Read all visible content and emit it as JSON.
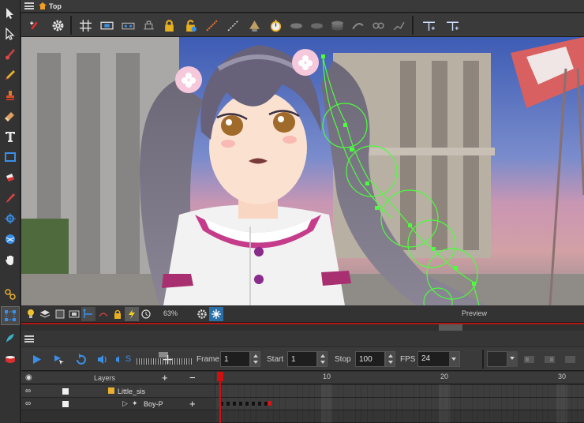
{
  "breadcrumb": {
    "label": "Top"
  },
  "left_tools": [
    {
      "name": "select-tool",
      "icon": "arrow-icon"
    },
    {
      "name": "contour-editor-tool",
      "icon": "arrow-white-icon"
    },
    {
      "name": "brush-tool",
      "icon": "brush-icon"
    },
    {
      "name": "pencil-tool",
      "icon": "pencil-icon"
    },
    {
      "name": "stamp-tool",
      "icon": "stamp-icon"
    },
    {
      "name": "eraser-tool",
      "icon": "eraser-icon"
    },
    {
      "name": "text-tool",
      "icon": "text-icon"
    },
    {
      "name": "rectangle-tool",
      "icon": "rectangle-icon"
    },
    {
      "name": "paint-tool",
      "icon": "paint-bucket-icon"
    },
    {
      "name": "dropper-tool",
      "icon": "dropper-icon"
    },
    {
      "name": "pivot-tool",
      "icon": "pivot-icon"
    },
    {
      "name": "morph-tool",
      "icon": "ball-icon"
    },
    {
      "name": "hand-tool",
      "icon": "hand-icon"
    },
    {
      "name": "bone-tool",
      "icon": "chain-icon"
    },
    {
      "name": "transform-tool",
      "icon": "transform-icon"
    },
    {
      "name": "cutter-tool",
      "icon": "feather-icon"
    },
    {
      "name": "onion-tool",
      "icon": "pot-icon"
    }
  ],
  "camera": {
    "zoom": "63%",
    "preview_label": "Preview"
  },
  "playback": {
    "frame_label": "Frame",
    "frame_value": "1",
    "start_label": "Start",
    "start_value": "1",
    "stop_label": "Stop",
    "stop_value": "100",
    "fps_label": "FPS",
    "fps_value": "24",
    "sound_label": "S"
  },
  "timeline": {
    "layers_header": "Layers",
    "layers": [
      {
        "name": "Little_sis"
      },
      {
        "name": "Boy-P"
      }
    ],
    "ruler": [
      "10",
      "20",
      "30"
    ],
    "current_frame": 1
  },
  "colors": {
    "accent_red": "#b01818",
    "playhead": "#d01010",
    "bone_green": "#4cff3c",
    "blue_icon": "#3a8fe8"
  }
}
